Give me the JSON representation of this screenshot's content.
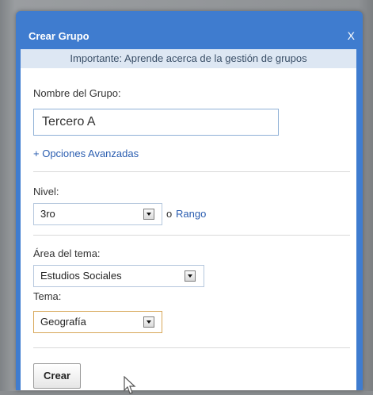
{
  "dialog": {
    "title": "Crear Grupo",
    "close_label": "X",
    "notice": "Importante: Aprende acerca de la gestión de grupos"
  },
  "group_name": {
    "label": "Nombre del Grupo:",
    "value": "Tercero A"
  },
  "advanced_options_label": "+ Opciones Avanzadas",
  "level": {
    "label": "Nivel:",
    "selected": "3ro",
    "range_prefix": "o",
    "range_link": "Rango"
  },
  "subject_area": {
    "label": "Área del tema:",
    "selected": "Estudios Sociales"
  },
  "topic": {
    "label": "Tema:",
    "selected": "Geografía"
  },
  "create_button_label": "Crear",
  "colors": {
    "title_bar": "#3f7ccf",
    "notice_background": "#dde7f3",
    "link": "#2a5db0"
  },
  "icons": {
    "dropdown": "chevron-down-icon",
    "pointer": "mouse-pointer-icon"
  }
}
